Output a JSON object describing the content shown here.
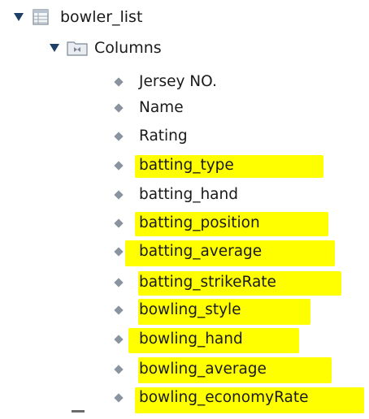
{
  "tree": {
    "root": {
      "label": "bowler_list",
      "icon": "table-icon",
      "expanded": true,
      "toggle_glyph": "▼"
    },
    "folder": {
      "label": "Columns",
      "icon": "columns-folder-icon",
      "expanded": true,
      "toggle_glyph": "▼"
    },
    "columns": [
      {
        "label": "Jersey NO.",
        "highlighted": false
      },
      {
        "label": "Name",
        "highlighted": false
      },
      {
        "label": "Rating",
        "highlighted": false
      },
      {
        "label": "batting_type",
        "highlighted": true
      },
      {
        "label": "batting_hand",
        "highlighted": false
      },
      {
        "label": "batting_position",
        "highlighted": true
      },
      {
        "label": "batting_average",
        "highlighted": true
      },
      {
        "label": "batting_strikeRate",
        "highlighted": true
      },
      {
        "label": "bowling_style",
        "highlighted": true
      },
      {
        "label": "bowling_hand",
        "highlighted": true
      },
      {
        "label": "bowling_average",
        "highlighted": true
      },
      {
        "label": "bowling_economyRate",
        "highlighted": true
      }
    ]
  },
  "colors": {
    "highlight": "#ffff00",
    "toggle": "#1f3f66",
    "diamond": "#8a93a0",
    "text": "#1a1a1a"
  }
}
